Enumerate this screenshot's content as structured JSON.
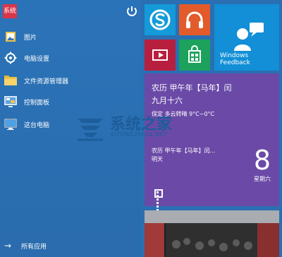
{
  "left": {
    "user_avatar_text": "系统",
    "menu": [
      {
        "label": "图片",
        "icon": "photos-icon"
      },
      {
        "label": "电脑设置",
        "icon": "settings-gear-icon"
      },
      {
        "label": "文件资源管理器",
        "icon": "file-explorer-icon"
      },
      {
        "label": "控制面板",
        "icon": "control-panel-icon"
      },
      {
        "label": "这台电脑",
        "icon": "this-pc-icon"
      }
    ],
    "all_apps": "所有应用"
  },
  "tiles": {
    "feedback_label_line1": "Windows",
    "feedback_label_line2": "Feedback",
    "calendar": {
      "line1": "农历 甲午年【马年】闰",
      "line2": "九月十六",
      "weather": "保定 多云转晴 9°C~0°C",
      "small_line1": "农历 甲午年【马年】闰...",
      "small_line2": "明天",
      "day": "8",
      "weekday": "星期六"
    }
  },
  "watermark": {
    "title": "系统之家",
    "subtitle": "XITONGZHIJIA.NET"
  },
  "colors": {
    "start_menu_bg": "#2b73b8",
    "skype_tile": "#149ad9",
    "music_tile": "#e35b2b",
    "video_tile": "#b81f3f",
    "store_tile": "#1ca25c",
    "feedback_tile": "#128fd6",
    "calendar_tile": "#6b4aa7"
  }
}
